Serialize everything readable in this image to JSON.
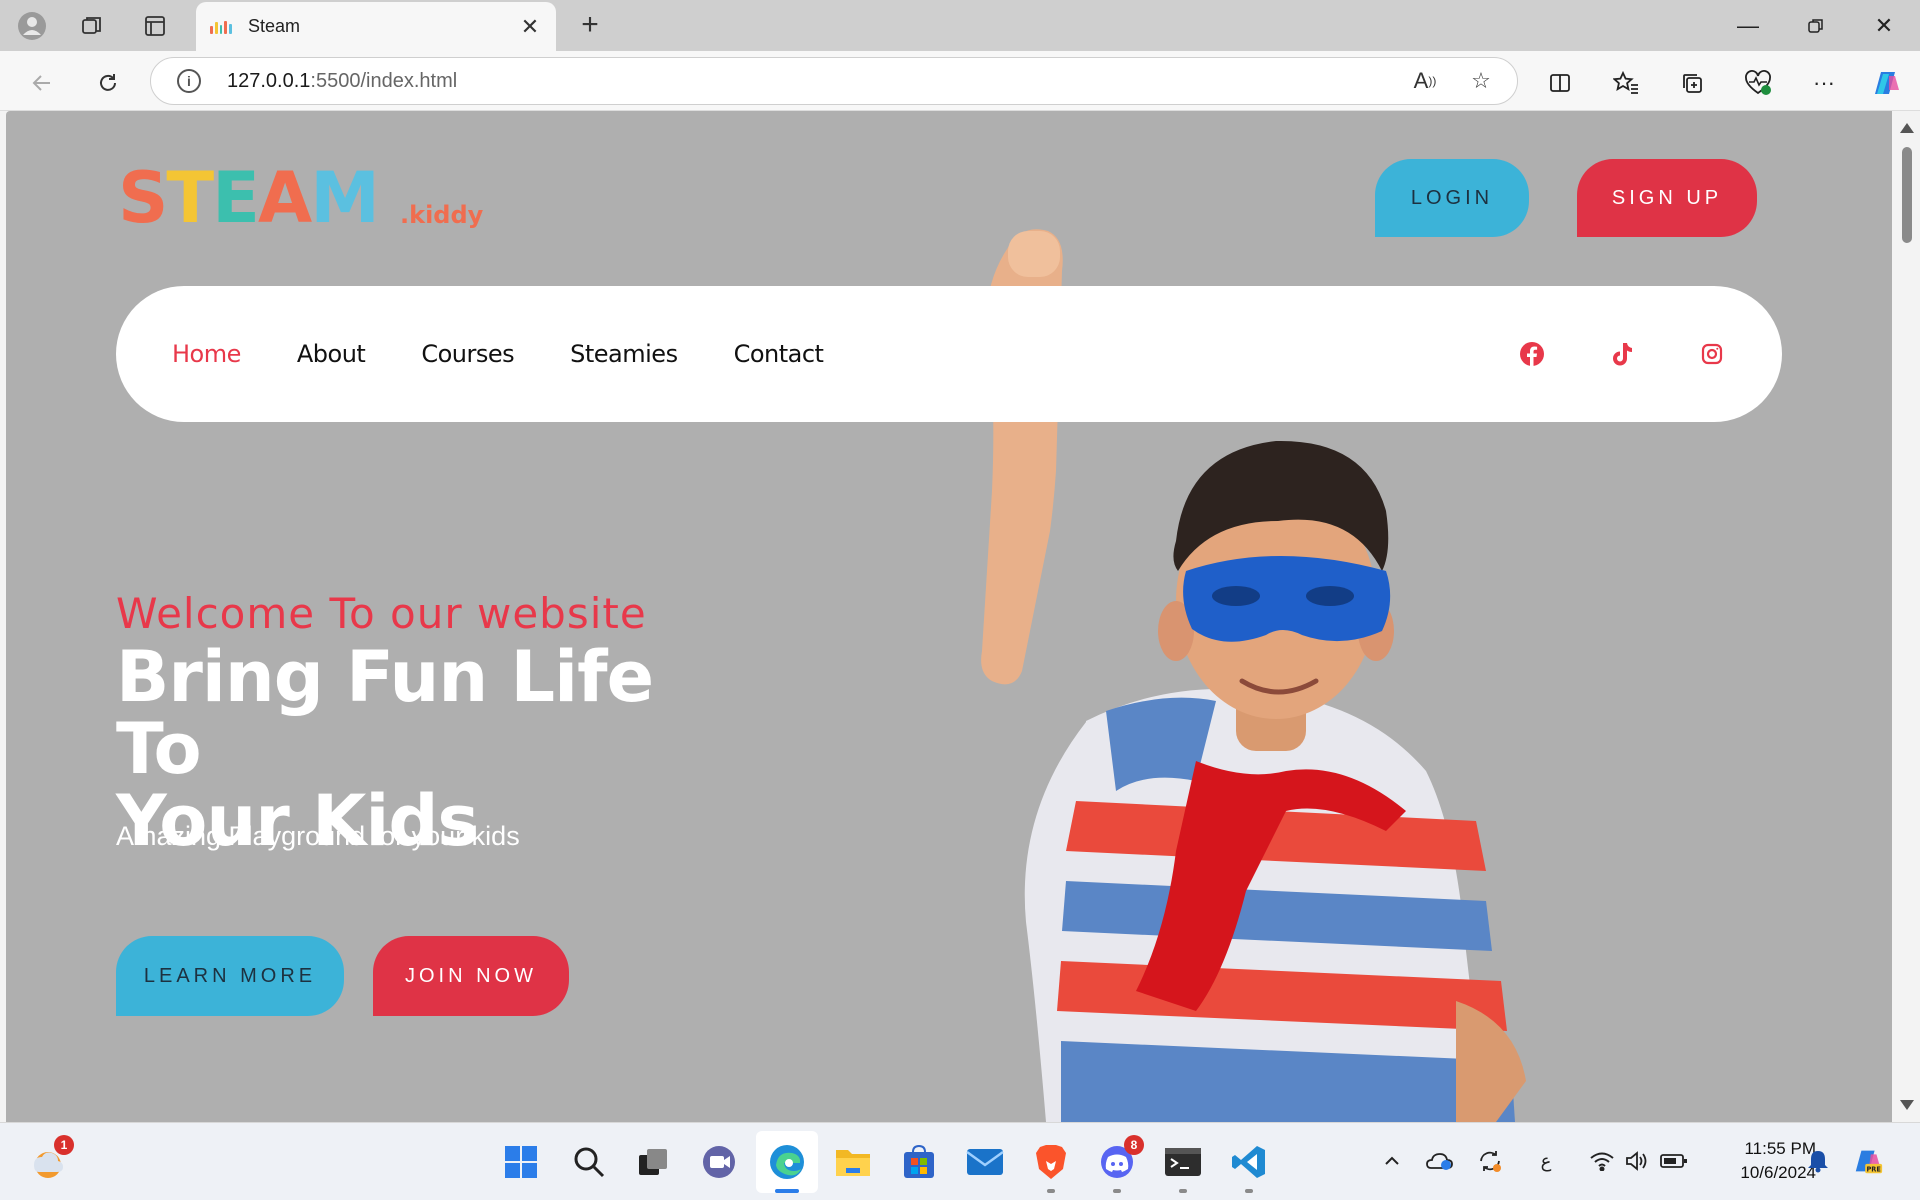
{
  "browser": {
    "tab_title": "Steam",
    "url_host": "127.0.0.1",
    "url_path": ":5500/index.html",
    "icons": {
      "profile": "profile-icon",
      "workspaces": "workspaces-icon",
      "tab_actions": "tab-actions-icon",
      "close_tab": "close-icon",
      "new_tab": "plus-icon",
      "back": "back-arrow-icon",
      "refresh": "refresh-icon",
      "site_info": "info-icon",
      "read_aloud": "read-aloud-icon",
      "favorite": "star-icon",
      "split_screen": "split-screen-icon",
      "favorites": "favorites-icon",
      "collections": "collections-icon",
      "browser_essentials": "heart-pulse-icon",
      "more": "more-icon",
      "copilot": "copilot-icon"
    }
  },
  "site": {
    "logo_letters": [
      "S",
      "T",
      "E",
      "A",
      "M"
    ],
    "logo_colors": [
      "#f06d4f",
      "#f4c534",
      "#3cbfae",
      "#f06d4f",
      "#5bc0e0"
    ],
    "logo_suffix": ".kiddy",
    "header": {
      "login_label": "LOGIN",
      "signup_label": "SIGN UP"
    },
    "nav": {
      "items": [
        {
          "label": "Home",
          "active": true
        },
        {
          "label": "About",
          "active": false
        },
        {
          "label": "Courses",
          "active": false
        },
        {
          "label": "Steamies",
          "active": false
        },
        {
          "label": "Contact",
          "active": false
        }
      ],
      "social": [
        "facebook-icon",
        "tiktok-icon",
        "instagram-icon"
      ]
    },
    "hero": {
      "welcome": "Welcome To our website",
      "headline_line1": "Bring Fun Life To",
      "headline_line2": "Your Kids",
      "subtitle": "Amazing Playground for your kids",
      "learn_more_label": "LEARN MORE",
      "join_now_label": "JOIN NOW"
    },
    "colors": {
      "background": "#afafaf",
      "accent_red": "#df3346",
      "accent_blue": "#3cb3d8"
    }
  },
  "taskbar": {
    "weather_badge": "1",
    "discord_badge": "8",
    "time": "11:55 PM",
    "date": "10/6/2024",
    "language": "ع",
    "apps": [
      "start-icon",
      "search-icon",
      "task-view-icon",
      "teams-icon",
      "edge-icon",
      "file-explorer-icon",
      "store-icon",
      "mail-icon",
      "brave-icon",
      "discord-icon",
      "terminal-icon",
      "vscode-icon"
    ]
  }
}
